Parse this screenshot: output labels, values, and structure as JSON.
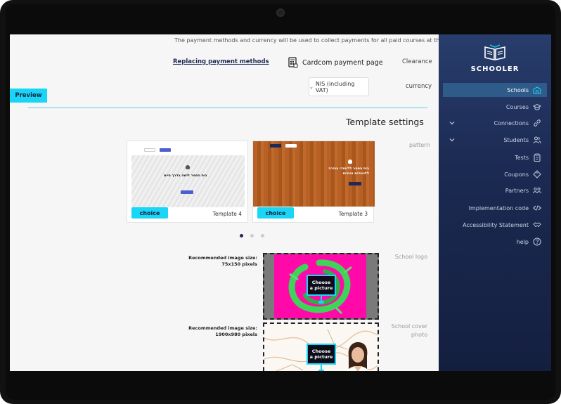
{
  "main": {
    "info_line": "The payment methods and currency will be used to collect payments for all paid courses at the school.",
    "replacing_link": "Replacing payment methods",
    "cardcom_label": "Cardcom payment page",
    "clearance_label": "Clearance",
    "currency_value": "NIS (including VAT)",
    "currency_label": "currency",
    "preview_label": "Preview",
    "template_settings_title": "Template settings",
    "pattern_label": "pattern",
    "templates": [
      {
        "name": "Template 4",
        "choice_label": "choice",
        "headline": "בית הספר לישה בדרך חיים"
      },
      {
        "name": "Template 3",
        "choice_label": "choice",
        "headline": "בית הספר ללימודי צבירה ללימודים והחיים"
      }
    ],
    "carousel": {
      "count": 3,
      "active_index": 0
    },
    "school_logo": {
      "label": "School logo",
      "recommended_line1": "Recommended image size:",
      "recommended_line2": "75x150 pixels",
      "choose_label_1": "Choose",
      "choose_label_2": "a picture"
    },
    "school_cover": {
      "label_line1": "School cover",
      "label_line2": "photo",
      "recommended_line1": "Recommended image size:",
      "recommended_line2": "1900x980 pixels",
      "choose_label_1": "Choose",
      "choose_label_2": "a picture"
    }
  },
  "sidebar": {
    "brand": "SCHOOLER",
    "items": [
      {
        "label": "Schools",
        "icon": "school-building-icon",
        "active": true
      },
      {
        "label": "Courses",
        "icon": "graduation-cap-icon",
        "active": false
      },
      {
        "label": "Connections",
        "icon": "link-icon",
        "active": false,
        "expandable": true
      },
      {
        "label": "Students",
        "icon": "users-icon",
        "active": false,
        "expandable": true
      },
      {
        "label": "Tests",
        "icon": "clipboard-icon",
        "active": false
      },
      {
        "label": "Coupons",
        "icon": "tag-icon",
        "active": false
      },
      {
        "label": "Partners",
        "icon": "partners-icon",
        "active": false
      },
      {
        "label": "Implementation code",
        "icon": "code-icon",
        "active": false
      },
      {
        "label": "Accessibility Statement",
        "icon": "handshake-icon",
        "active": false
      },
      {
        "label": "help",
        "icon": "question-circle-icon",
        "active": false
      }
    ]
  },
  "colors": {
    "accent": "#19d6f6",
    "sidebar_dark": "#141f40",
    "active_item": "#2f5b8a",
    "primary_text": "#1e2a55"
  }
}
